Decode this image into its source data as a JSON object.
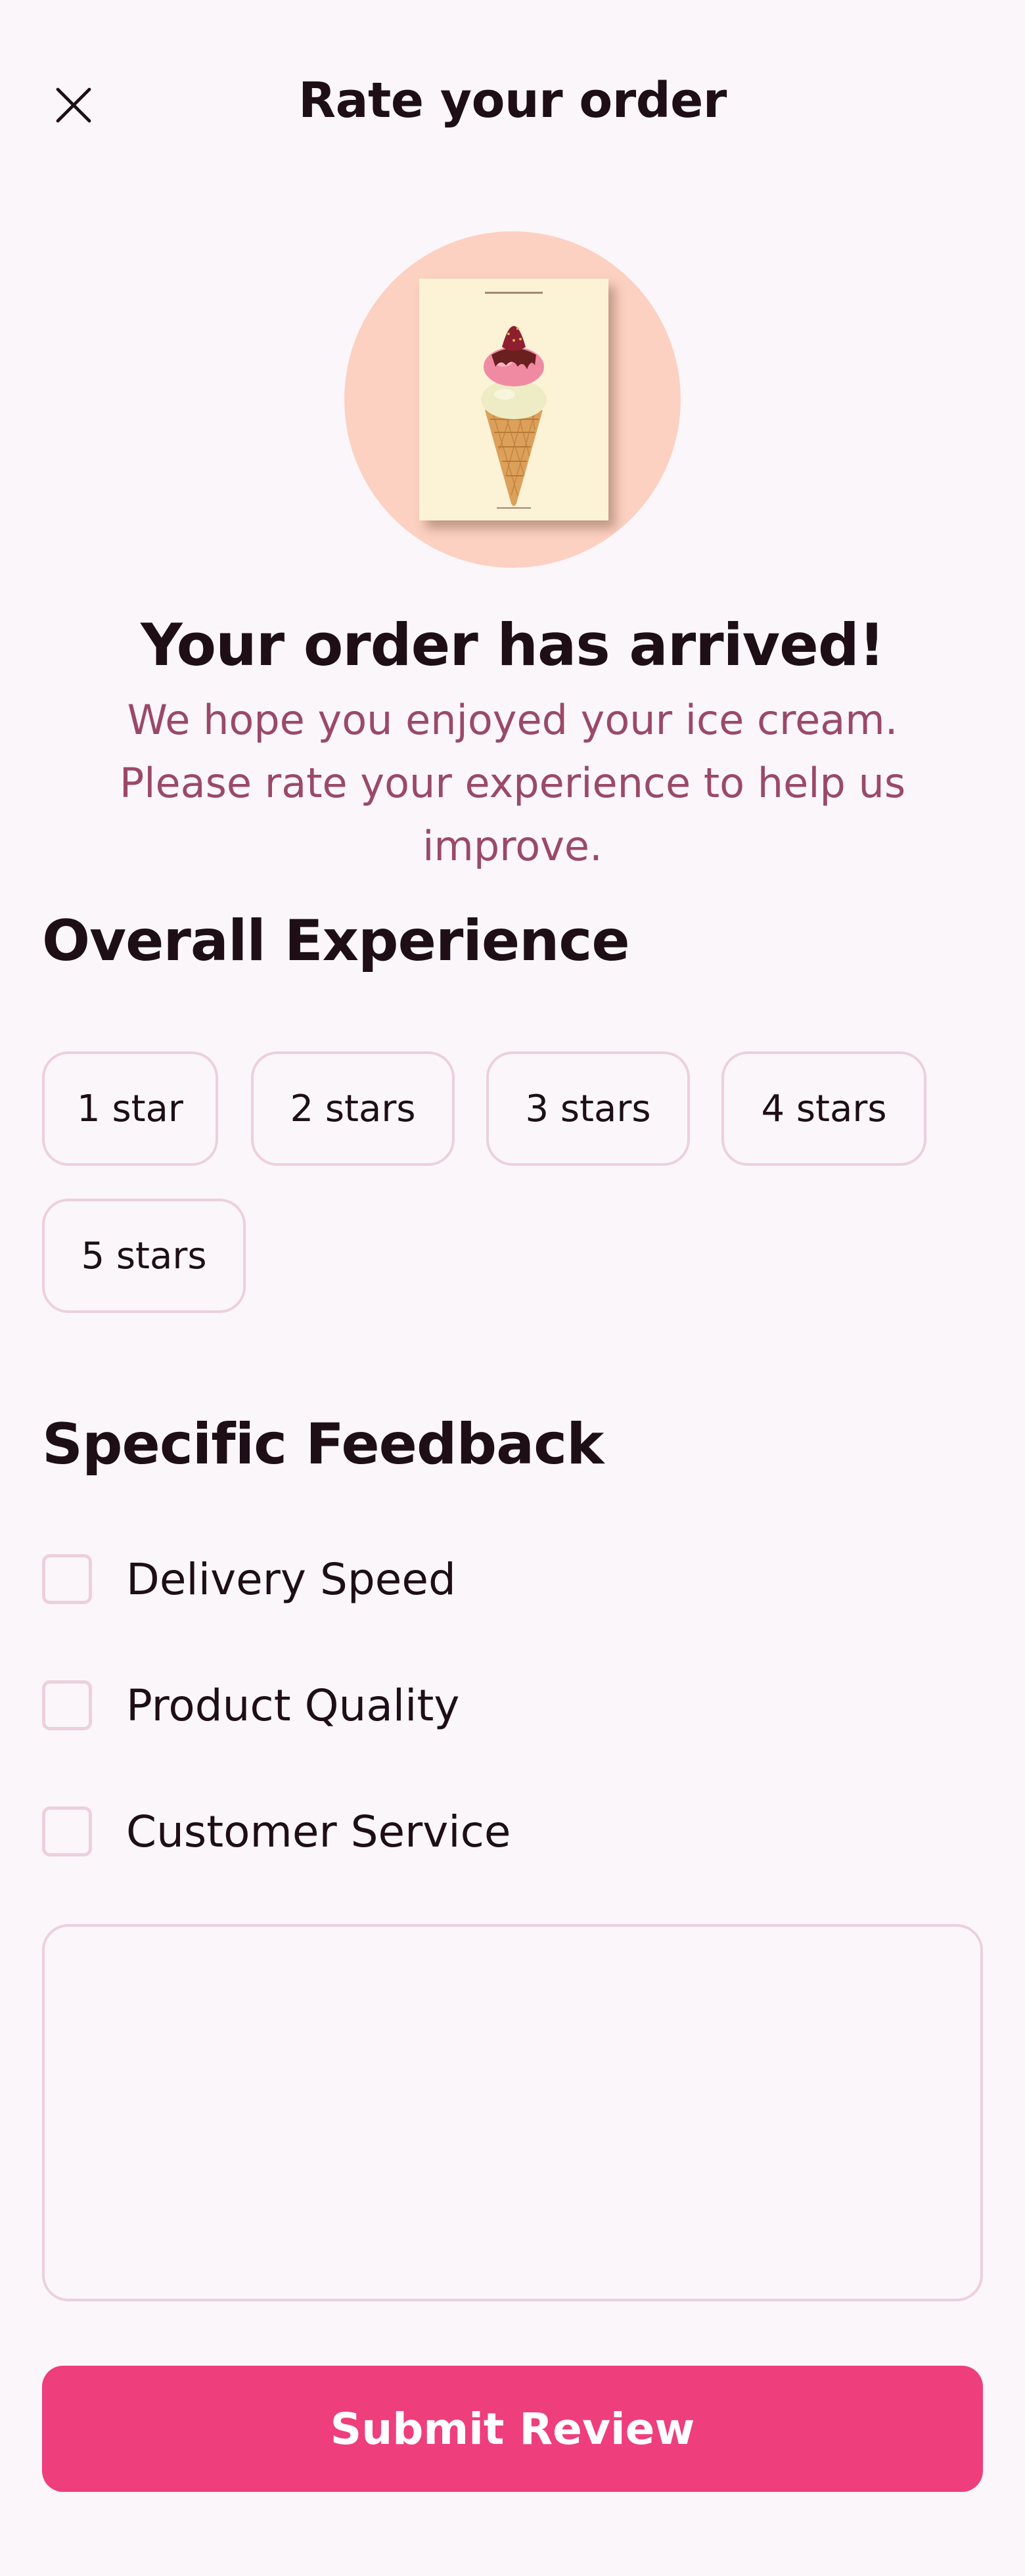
{
  "header": {
    "title": "Rate your order",
    "close_icon": "close-icon"
  },
  "hero": {
    "image": "ice-cream-cone-poster",
    "background_color": "#fcd1c2"
  },
  "arrival": {
    "title": "Your order has arrived!",
    "subtitle": "We hope you enjoyed your ice cream. Please rate your experience to help us improve."
  },
  "overall": {
    "title": "Overall Experience",
    "options": [
      "1 star",
      "2 stars",
      "3 stars",
      "4 stars",
      "5 stars"
    ]
  },
  "feedback": {
    "title": "Specific Feedback",
    "items": [
      "Delivery Speed",
      "Product Quality",
      "Customer Service"
    ],
    "comment_placeholder": ""
  },
  "submit": {
    "label": "Submit Review"
  },
  "colors": {
    "accent": "#ee3e7b",
    "subtitle": "#9a4a66",
    "border": "#ecd0dc",
    "background": "#fbf6fa"
  }
}
